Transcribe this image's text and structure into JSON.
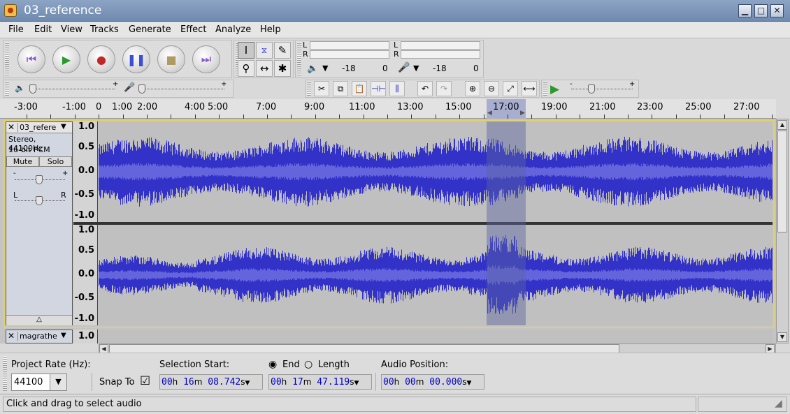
{
  "window": {
    "title": "03_reference"
  },
  "menu": [
    "File",
    "Edit",
    "View",
    "Tracks",
    "Generate",
    "Effect",
    "Analyze",
    "Help"
  ],
  "meter": {
    "left_label": "L",
    "right_label": "R",
    "play_db": "-18",
    "play_zero": "0",
    "rec_db": "-18",
    "rec_zero": "0"
  },
  "ruler": {
    "labels": [
      "-3:00",
      "-1:00",
      "0",
      "1:00",
      "2:00",
      "4:00",
      "5:00",
      "7:00",
      "9:00",
      "11:00",
      "13:00",
      "15:00",
      "17:00",
      "19:00",
      "21:00",
      "23:00",
      "25:00",
      "27:00"
    ]
  },
  "track1": {
    "name": "03_refere",
    "format1": "Stereo, 44100Hz",
    "format2": "16-bit PCM",
    "mute": "Mute",
    "solo": "Solo",
    "pan_l": "L",
    "pan_r": "R",
    "gain_minus": "-",
    "gain_plus": "+",
    "scale": [
      "1.0",
      "0.5",
      "0.0",
      "-0.5",
      "-1.0"
    ],
    "collapse": "△"
  },
  "track2": {
    "name": "magrathe",
    "scale_top": "1.0"
  },
  "selection": {
    "project_rate_label": "Project Rate (Hz):",
    "project_rate": "44100",
    "snap_label": "Snap To",
    "snap_checked": "☑",
    "sel_start_label": "Selection Start:",
    "end_label": "End",
    "length_label": "Length",
    "audio_pos_label": "Audio Position:",
    "start": {
      "h": "00",
      "m": "16",
      "s": "08.742"
    },
    "end": {
      "h": "00",
      "m": "17",
      "s": "47.119"
    },
    "pos": {
      "h": "00",
      "m": "00",
      "s": "00.000"
    },
    "unit_h": "h",
    "unit_m": "m",
    "unit_s": "s"
  },
  "status": "Click and drag to select audio",
  "colors": {
    "wave": "#3232c8",
    "wave_rms": "#6464dc",
    "selection": "#8a8fb8",
    "track_bg": "#c0c0c0"
  }
}
